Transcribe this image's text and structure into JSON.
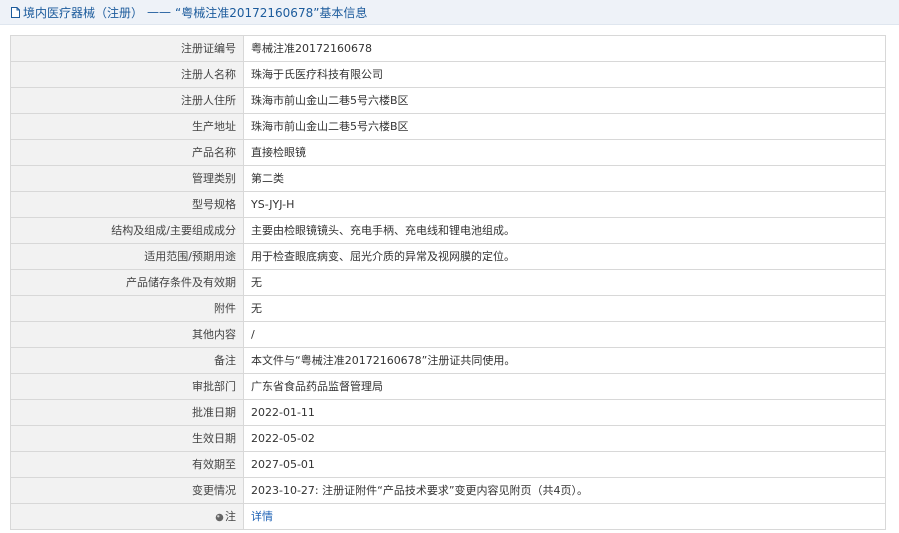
{
  "header": {
    "breadcrumb": "境内医疗器械（注册）",
    "separator": "——",
    "title": "“粤械注准20172160678”基本信息"
  },
  "rows": [
    {
      "label": "注册证编号",
      "value": "粤械注准20172160678"
    },
    {
      "label": "注册人名称",
      "value": "珠海于氏医疗科技有限公司"
    },
    {
      "label": "注册人住所",
      "value": "珠海市前山金山二巷5号六楼B区"
    },
    {
      "label": "生产地址",
      "value": "珠海市前山金山二巷5号六楼B区"
    },
    {
      "label": "产品名称",
      "value": "直接检眼镜"
    },
    {
      "label": "管理类别",
      "value": "第二类"
    },
    {
      "label": "型号规格",
      "value": "YS-JYJ-H"
    },
    {
      "label": "结构及组成/主要组成成分",
      "value": "主要由检眼镜镜头、充电手柄、充电线和锂电池组成。"
    },
    {
      "label": "适用范围/预期用途",
      "value": "用于检查眼底病变、屈光介质的异常及视网膜的定位。"
    },
    {
      "label": "产品储存条件及有效期",
      "value": "无"
    },
    {
      "label": "附件",
      "value": "无"
    },
    {
      "label": "其他内容",
      "value": "/"
    },
    {
      "label": "备注",
      "value": "本文件与“粤械注准20172160678”注册证共同使用。"
    },
    {
      "label": "审批部门",
      "value": "广东省食品药品监督管理局"
    },
    {
      "label": "批准日期",
      "value": "2022-01-11"
    },
    {
      "label": "生效日期",
      "value": "2022-05-02"
    },
    {
      "label": "有效期至",
      "value": "2027-05-01"
    },
    {
      "label": "变更情况",
      "value": "2023-10-27: 注册证附件“产品技术要求”变更内容见附页（共4页）。"
    }
  ],
  "note": {
    "label": "注",
    "link": "详情"
  }
}
